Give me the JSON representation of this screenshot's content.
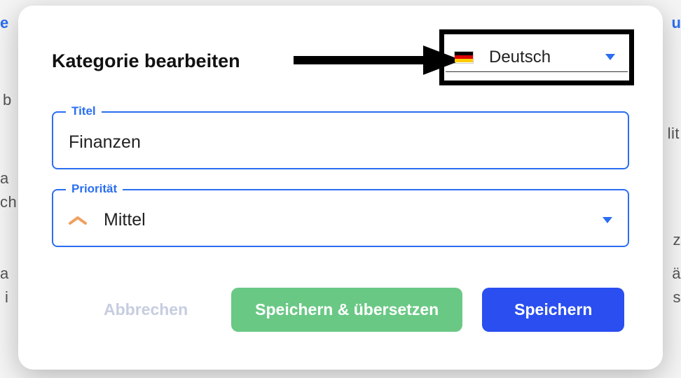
{
  "modal": {
    "title": "Kategorie bearbeiten",
    "language": {
      "label": "Deutsch",
      "flag_colors": [
        "#000000",
        "#DD0000",
        "#FFCC00"
      ]
    },
    "fields": {
      "title_label": "Titel",
      "title_value": "Finanzen",
      "priority_label": "Priorität",
      "priority_value": "Mittel"
    },
    "buttons": {
      "cancel": "Abbrechen",
      "save_translate": "Speichern & übersetzen",
      "save": "Speichern"
    }
  }
}
